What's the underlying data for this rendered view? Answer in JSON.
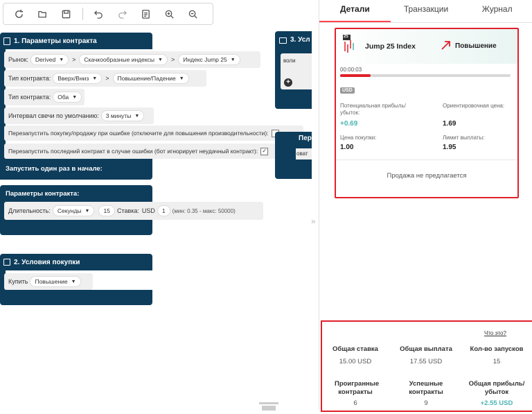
{
  "workspace": {
    "block1": {
      "title": "1. Параметры контракта",
      "market_label": "Рынок:",
      "market_values": [
        "Derived",
        "Скачкообразные индексы",
        "Индекс Jump 25"
      ],
      "trade_type_label": "Тип контракта:",
      "trade_type_values": [
        "Вверх/Вниз",
        "Повышение/Падение"
      ],
      "contract_type_label": "Тип контракта:",
      "contract_type_value": "Оба",
      "candle_label": "Интервал свечи по умолчанию:",
      "candle_value": "3 минуты",
      "restart_error_label": "Перезапустить покупку/продажу при ошибке (отключите для повышения производительности):",
      "restart_last_label": "Перезапустить последний контракт в случае ошибки (бот игнорирует неудачный контракт):",
      "run_once_label": "Запустить один раз в начале:",
      "params_label": "Параметры контракта:",
      "duration_label": "Длительность:",
      "duration_unit": "Секунды",
      "duration_value": "15",
      "stake_label": "Ставка:",
      "stake_currency": "USD",
      "stake_value": "1",
      "stake_range": "(мин: 0.35 - макс: 50000)"
    },
    "block3": {
      "title": "3. Усл",
      "text": "воли",
      "partial_title": "Пер",
      "partial_text": "оват"
    },
    "block2": {
      "title": "2. Условия покупки",
      "buy_label": "Купить",
      "buy_value": "Повышение"
    }
  },
  "panel": {
    "tabs": [
      "Детали",
      "Транзакции",
      "Журнал"
    ],
    "contract": {
      "badge": "25",
      "symbol": "Jump 25 Index",
      "direction": "Повышение",
      "timer": "00:00:03",
      "progress": 0.18,
      "currency": "USD",
      "profit_label": "Потенциальная прибыль/ убыток:",
      "profit_value": "+0.69",
      "est_price_label": "Ориентировочная цена:",
      "est_price_value": "1.69",
      "buy_price_label": "Цена покупки:",
      "buy_price_value": "1.00",
      "payout_limit_label": "Лимит выплаты:",
      "payout_limit_value": "1.95",
      "sell_note": "Продажа не предлагается"
    },
    "stats": {
      "what_link": "Что это?",
      "total_stake_label": "Общая ставка",
      "total_stake_value": "15.00 USD",
      "total_payout_label": "Общая выплата",
      "total_payout_value": "17.55 USD",
      "runs_label": "Кол-во запусков",
      "runs_value": "15",
      "lost_label": "Проигранные контракты",
      "lost_value": "6",
      "won_label": "Успешные контракты",
      "won_value": "9",
      "pnl_label": "Общая прибыль/ убыток",
      "pnl_value": "+2.55 USD"
    }
  },
  "colors": {
    "block": "#0e3d5b",
    "accent": "#ff444f",
    "profit": "#4bb4b3",
    "highlight": "#e0202a"
  }
}
